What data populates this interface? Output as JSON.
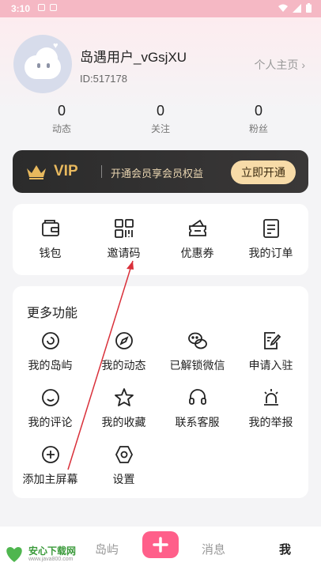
{
  "status_bar": {
    "time": "3:10"
  },
  "profile": {
    "username": "岛遇用户_vGsjXU",
    "user_id": "ID:517178",
    "homepage_link": "个人主页 ›"
  },
  "stats": [
    {
      "count": "0",
      "label": "动态"
    },
    {
      "count": "0",
      "label": "关注"
    },
    {
      "count": "0",
      "label": "粉丝"
    }
  ],
  "vip": {
    "label": "VIP",
    "description": "开通会员享会员权益",
    "button": "立即开通",
    "accent_color": "#e8b95e"
  },
  "quick_actions": [
    {
      "label": "钱包",
      "icon": "wallet-icon"
    },
    {
      "label": "邀请码",
      "icon": "qr-code-icon"
    },
    {
      "label": "优惠券",
      "icon": "coupon-icon"
    },
    {
      "label": "我的订单",
      "icon": "order-icon"
    }
  ],
  "more_features": {
    "title": "更多功能",
    "items": [
      {
        "label": "我的岛屿",
        "icon": "island-icon"
      },
      {
        "label": "我的动态",
        "icon": "compass-icon"
      },
      {
        "label": "已解锁微信",
        "icon": "wechat-icon"
      },
      {
        "label": "申请入驻",
        "icon": "edit-icon"
      },
      {
        "label": "我的评论",
        "icon": "comment-icon"
      },
      {
        "label": "我的收藏",
        "icon": "star-icon"
      },
      {
        "label": "联系客服",
        "icon": "headset-icon"
      },
      {
        "label": "我的举报",
        "icon": "alarm-icon"
      },
      {
        "label": "添加主屏幕",
        "icon": "add-circle-icon"
      },
      {
        "label": "设置",
        "icon": "settings-icon"
      }
    ]
  },
  "tab_bar": {
    "tabs": [
      "岛屿",
      "消息",
      "我"
    ],
    "active": "我",
    "plus_color": "#ff5f8a"
  },
  "watermark": {
    "name": "安心下载网",
    "url": "www.java800.com"
  }
}
